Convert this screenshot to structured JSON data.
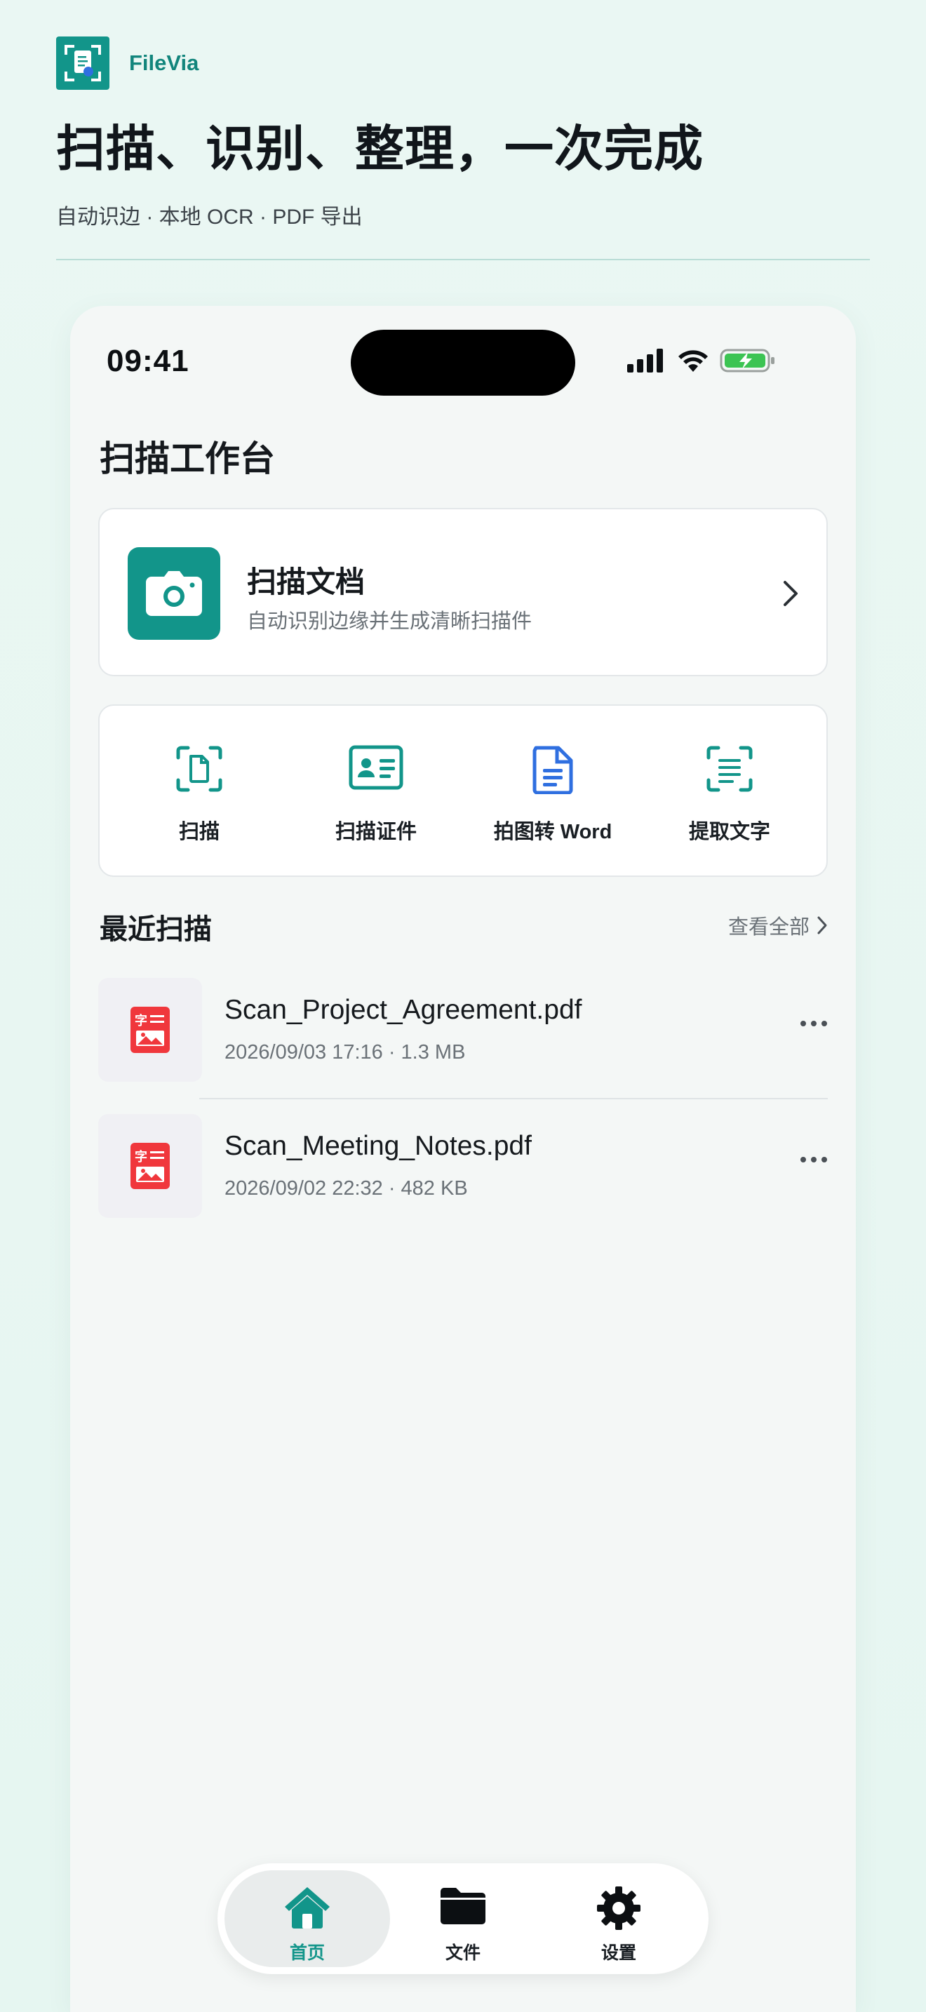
{
  "brand": {
    "name": "FileVia",
    "logo_icon": "document-scan-logo-icon"
  },
  "hero": {
    "headline": "扫描、识别、整理，一次完成",
    "tagline": "自动识边 · 本地 OCR · PDF 导出"
  },
  "status_bar": {
    "time": "09:41",
    "icons": [
      "signal-icon",
      "wifi-icon",
      "battery-charging-icon"
    ]
  },
  "page": {
    "title": "扫描工作台"
  },
  "scan_card": {
    "title": "扫描文档",
    "subtitle": "自动识别边缘并生成清晰扫描件",
    "icon": "camera-icon"
  },
  "tools": [
    {
      "label": "扫描",
      "icon": "scan-document-icon"
    },
    {
      "label": "扫描证件",
      "icon": "id-card-icon"
    },
    {
      "label": "拍图转 Word",
      "icon": "word-document-icon"
    },
    {
      "label": "提取文字",
      "icon": "text-extract-icon"
    }
  ],
  "recent": {
    "title": "最近扫描",
    "see_all": "查看全部",
    "files": [
      {
        "name": "Scan_Project_Agreement.pdf",
        "meta": "2026/09/03 17:16 · 1.3 MB"
      },
      {
        "name": "Scan_Meeting_Notes.pdf",
        "meta": "2026/09/02 22:32 · 482 KB"
      }
    ]
  },
  "tabbar": {
    "tabs": [
      {
        "label": "首页",
        "icon": "home-icon",
        "active": true
      },
      {
        "label": "文件",
        "icon": "folder-icon",
        "active": false
      },
      {
        "label": "设置",
        "icon": "gear-icon",
        "active": false
      }
    ]
  },
  "colors": {
    "accent": "#12958a",
    "pdf_red": "#f0373c",
    "word_blue": "#2f6fe0"
  }
}
